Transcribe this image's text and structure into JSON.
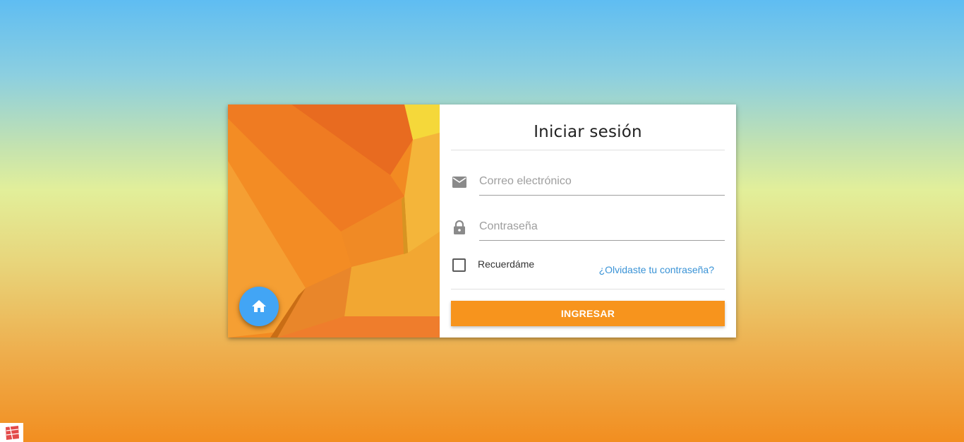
{
  "login": {
    "title": "Iniciar sesión",
    "email_placeholder": "Correo electrónico",
    "password_placeholder": "Contraseña",
    "remember_label": "Recuerdáme",
    "forgot_link": "¿Olvidaste tu contraseña?",
    "submit_label": "INGRESAR"
  },
  "icons": {
    "home": "home-icon",
    "email": "email-icon",
    "lock": "lock-icon",
    "corner_logo": "brand-logo-icon"
  },
  "colors": {
    "accent": "#f7941d",
    "link": "#3a93d6",
    "fab": "#42a5f5"
  }
}
